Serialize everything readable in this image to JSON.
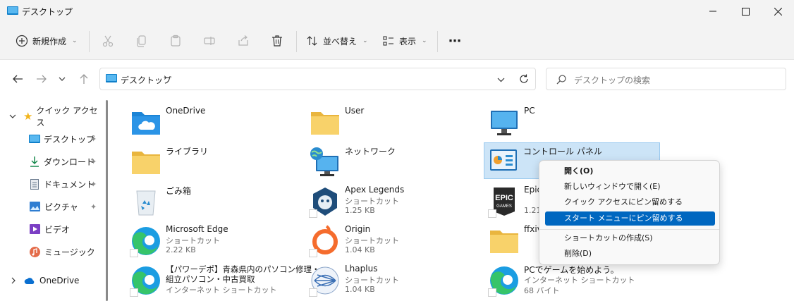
{
  "window": {
    "title": "デスクトップ"
  },
  "commandbar": {
    "new_label": "新規作成",
    "sort_label": "並べ替え",
    "view_label": "表示",
    "more_label": "⋯"
  },
  "address": {
    "crumb": "デスクトップ",
    "search_placeholder": "デスクトップの検索"
  },
  "nav": {
    "quick_access": "クイック アクセス",
    "items": [
      {
        "label": "デスクトップ"
      },
      {
        "label": "ダウンロード"
      },
      {
        "label": "ドキュメント"
      },
      {
        "label": "ピクチャ"
      },
      {
        "label": "ビデオ"
      },
      {
        "label": "ミュージック"
      }
    ],
    "onedrive": "OneDrive"
  },
  "files": [
    {
      "name": "OneDrive"
    },
    {
      "name": "User"
    },
    {
      "name": "PC"
    },
    {
      "name": "ライブラリ"
    },
    {
      "name": "ネットワーク"
    },
    {
      "name": "コントロール パネル"
    },
    {
      "name": "ごみ箱"
    },
    {
      "name": "Apex Legends",
      "type": "ショートカット",
      "size": "1.25 KB"
    },
    {
      "name": "Epic",
      "size": "1.21"
    },
    {
      "name": "Microsoft Edge",
      "type": "ショートカット",
      "size": "2.22 KB"
    },
    {
      "name": "Origin",
      "type": "ショートカット",
      "size": "1.04 KB"
    },
    {
      "name": "ffxiv"
    },
    {
      "name": "【パワーデポ】青森県内のパソコン修理・",
      "name2": "組立パソコン・中古買取",
      "type": "インターネット ショートカット"
    },
    {
      "name": "Lhaplus",
      "type": "ショートカット",
      "size": "1.04 KB"
    },
    {
      "name": "PCでゲームを始めよう。",
      "type": "インターネット ショートカット",
      "size": "68 バイト"
    }
  ],
  "context_menu": {
    "items": [
      {
        "label": "開く(O)"
      },
      {
        "label": "新しいウィンドウで開く(E)"
      },
      {
        "label": "クイック アクセスにピン留めする"
      },
      {
        "label": "スタート メニューにピン留めする"
      },
      {
        "label": "ショートカットの作成(S)"
      },
      {
        "label": "削除(D)"
      }
    ]
  },
  "colors": {
    "accent": "#0067c0",
    "selection": "#cce4f7",
    "folder": "#f8cd55"
  }
}
